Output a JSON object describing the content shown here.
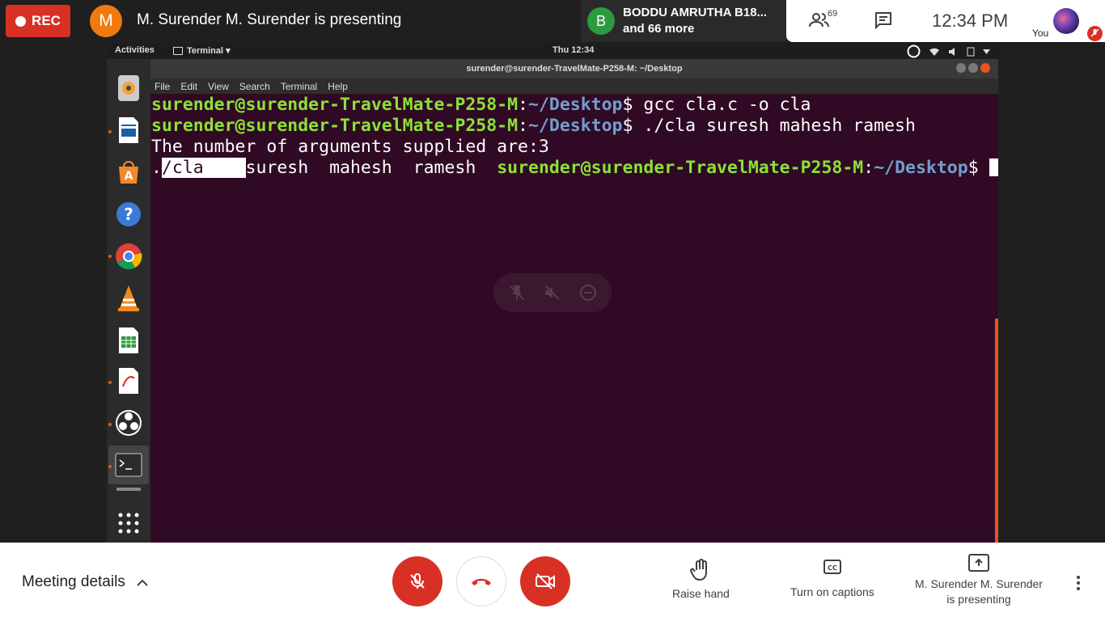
{
  "meet": {
    "rec_label": "REC",
    "presenter_initial": "M",
    "presenting_title": "M. Surender M. Surender is presenting",
    "participant_initial": "B",
    "participant_name": "BODDU AMRUTHA B18...",
    "participant_more": "and 66 more",
    "people_count": "69",
    "clock": "12:34  PM",
    "you_label": "You",
    "meeting_details": "Meeting details",
    "raise_hand": "Raise hand",
    "captions": "Turn on captions",
    "presenting_line1": "M. Surender M. Surender",
    "presenting_line2": "is presenting",
    "colors": {
      "rec": "#d93025",
      "avatar": "#f2790e",
      "participant": "#2e9a3e"
    }
  },
  "ubuntu": {
    "activities": "Activities",
    "app_name": "Terminal ▾",
    "clock": "Thu 12:34",
    "window_title": "surender@surender-TravelMate-P258-M: ~/Desktop",
    "menu": [
      "File",
      "Edit",
      "View",
      "Search",
      "Terminal",
      "Help"
    ]
  },
  "terminal": {
    "user_host": "surender@surender-TravelMate-P258-M",
    "colon": ":",
    "path": "~/Desktop",
    "dollar": "$ ",
    "cmd1": "gcc cla.c -o cla",
    "cmd2": "./cla suresh mahesh ramesh",
    "output1": "The number of arguments supplied are:3",
    "output2_prefix": ".",
    "output2_selected": "/cla    ",
    "output2_rest": "suresh  mahesh  ramesh  ",
    "colors": {
      "bg": "#300a24",
      "user": "#8ae234",
      "path": "#729fcf"
    }
  }
}
